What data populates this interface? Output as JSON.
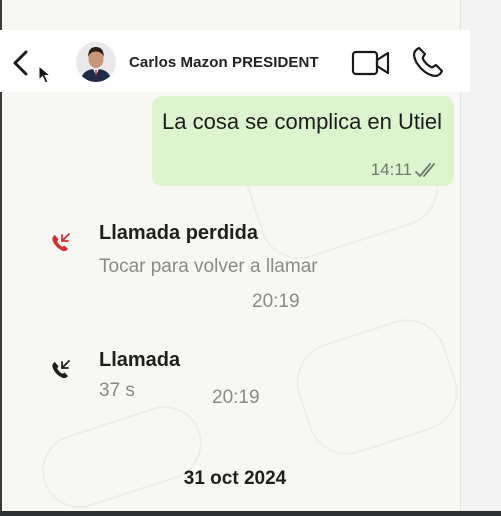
{
  "header": {
    "contact_name": "Carlos Mazon PRESIDENT",
    "back_icon": "chevron-left-icon",
    "video_icon": "video-camera-icon",
    "phone_icon": "phone-icon"
  },
  "messages": [
    {
      "text": "La cosa se complica en Utiel",
      "time": "14:11",
      "status_icon": "double-check-icon",
      "color": "#dcf5cf"
    }
  ],
  "calls": [
    {
      "title": "Llamada perdida",
      "subtitle": "Tocar para volver a llamar",
      "time": "20:19",
      "icon": "missed-call-icon",
      "icon_color": "#d9302f"
    },
    {
      "title": "Llamada",
      "subtitle": "37 s",
      "time": "20:19",
      "icon": "incoming-call-icon",
      "icon_color": "#1f1f1f"
    }
  ],
  "date_separator": "31 oct 2024"
}
